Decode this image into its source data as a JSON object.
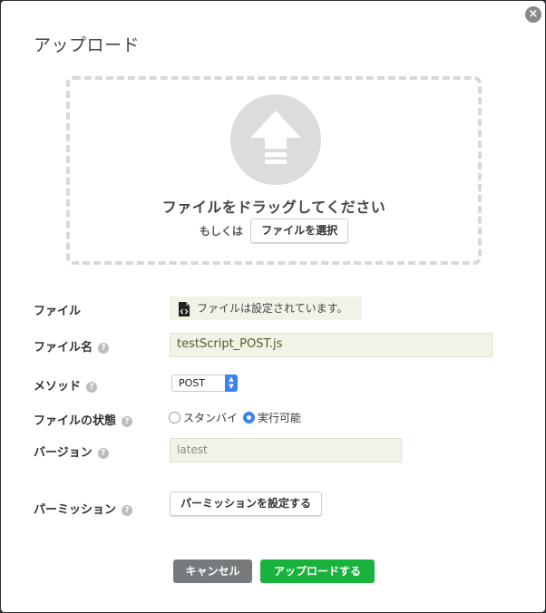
{
  "dialog": {
    "title": "アップロード",
    "close_icon": "close-icon"
  },
  "dropzone": {
    "icon": "upload-arrow-icon",
    "drag_text": "ファイルをドラッグしてください",
    "or_label": "もしくは",
    "select_button": "ファイルを選択"
  },
  "form": {
    "file_label": "ファイル",
    "file_status_icon": "code-file-icon",
    "file_status_text": "ファイルは設定されています。",
    "filename_label": "ファイル名",
    "filename_value": "testScript_POST.js",
    "method_label": "メソッド",
    "method_value": "POST",
    "state_label": "ファイルの状態",
    "state_options": [
      {
        "label": "スタンバイ",
        "checked": false
      },
      {
        "label": "実行可能",
        "checked": true
      }
    ],
    "version_label": "バージョン",
    "version_placeholder": "latest",
    "permission_label": "パーミッション",
    "permission_button": "パーミッションを設定する",
    "help_glyph": "?"
  },
  "footer": {
    "cancel_button": "キャンセル",
    "upload_button": "アップロードする"
  },
  "colors": {
    "primary_green": "#19b23c",
    "cancel_gray": "#777b7e",
    "radio_blue": "#3b83f1",
    "field_bg": "#f3f2e6"
  }
}
